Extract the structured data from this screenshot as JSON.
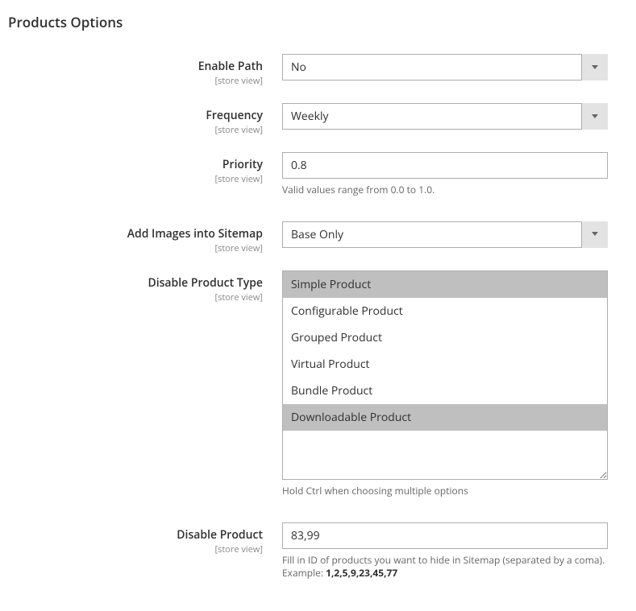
{
  "section": {
    "title": "Products Options"
  },
  "scope_label": "[store view]",
  "fields": {
    "enable_path": {
      "label": "Enable Path",
      "value": "No"
    },
    "frequency": {
      "label": "Frequency",
      "value": "Weekly"
    },
    "priority": {
      "label": "Priority",
      "value": "0.8",
      "hint": "Valid values range from 0.0 to 1.0."
    },
    "add_images": {
      "label": "Add Images into Sitemap",
      "value": "Base Only"
    },
    "disable_product_type": {
      "label": "Disable Product Type",
      "options": [
        {
          "label": "Simple Product",
          "selected": true
        },
        {
          "label": "Configurable Product",
          "selected": false
        },
        {
          "label": "Grouped Product",
          "selected": false
        },
        {
          "label": "Virtual Product",
          "selected": false
        },
        {
          "label": "Bundle Product",
          "selected": false
        },
        {
          "label": "Downloadable Product",
          "selected": true
        }
      ],
      "hint": "Hold Ctrl when choosing multiple options"
    },
    "disable_product": {
      "label": "Disable Product",
      "value": "83,99",
      "hint_prefix": "Fill in ID of products you want to hide in Sitemap (separated by a coma). Example: ",
      "hint_example": "1,2,5,9,23,45,77"
    }
  }
}
